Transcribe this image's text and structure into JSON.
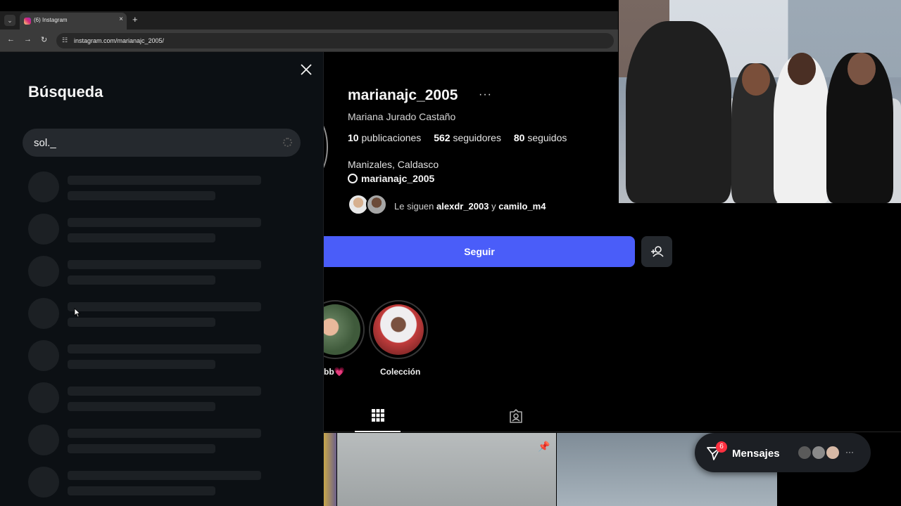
{
  "browser": {
    "tab_title": "(6) Instagram",
    "url": "instagram.com/marianajc_2005/",
    "new_tab_label": "+",
    "tab_close_label": "×",
    "menu_label": "⌄"
  },
  "search": {
    "title": "Búsqueda",
    "query": "sol._",
    "skeleton_rows": 8
  },
  "profile": {
    "username": "marianajc_2005",
    "more_label": "···",
    "full_name": "Mariana Jurado Castaño",
    "stats": {
      "posts_count": "10",
      "posts_label": "publicaciones",
      "followers_count": "562",
      "followers_label": "seguidores",
      "following_count": "80",
      "following_label": "seguidos"
    },
    "location": "Manizales, Caldasco",
    "threads_handle": "marianajc_2005",
    "followed_by": {
      "prefix": "Le siguen",
      "user1": "alexdr_2003",
      "conj": "y",
      "user2": "camilo_m4"
    },
    "follow_label": "Seguir",
    "highlights": [
      {
        "label": "bb💗"
      },
      {
        "label": "Colección"
      }
    ]
  },
  "messages": {
    "label": "Mensajes",
    "badge": "6",
    "more_label": "···"
  },
  "colors": {
    "follow_button": "#4a5df9",
    "badge": "#ff3040",
    "drawer_bg": "#0c1014"
  }
}
